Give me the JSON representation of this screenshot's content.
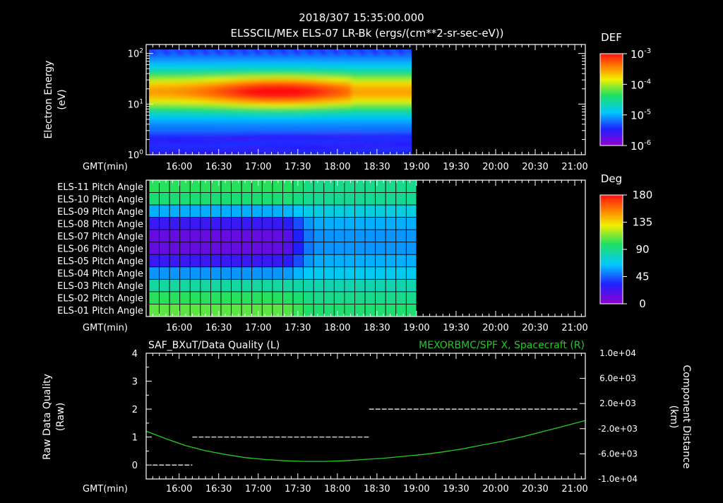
{
  "header": {
    "title": "2018/307 15:35:00.000",
    "subtitle": "ELSSCIL/MEx ELS-07 LR-Bk  (ergs/(cm**2-sr-sec-eV))"
  },
  "time_axis": {
    "label": "GMT(min)",
    "ticks": [
      "16:00",
      "16:30",
      "17:00",
      "17:30",
      "18:00",
      "18:30",
      "19:00",
      "19:30",
      "20:00",
      "20:30",
      "21:00"
    ],
    "tick_minutes": [
      960,
      990,
      1020,
      1050,
      1080,
      1110,
      1140,
      1170,
      1200,
      1230,
      1260
    ],
    "range_minutes": [
      935,
      1268
    ],
    "data_end_minutes": 1140
  },
  "colors": {
    "background": "#000000",
    "axis": "#ffffff",
    "green_series": "#22cc22"
  },
  "chart_data": [
    {
      "type": "heatmap",
      "name": "spectrogram",
      "ylabel_line1": "Electron Energy",
      "ylabel_line2": "(eV)",
      "y_scale": "log",
      "ylim": [
        1,
        150
      ],
      "y_ticks": [
        {
          "value": 100,
          "base": "10",
          "exp": "2"
        },
        {
          "value": 10,
          "base": "10",
          "exp": "1"
        },
        {
          "value": 1,
          "base": "10",
          "exp": "0"
        }
      ],
      "colorbar": {
        "label": "DEF",
        "scale": "log",
        "range": [
          1e-06,
          0.001
        ],
        "ticks": [
          {
            "base": "10",
            "exp": "-3"
          },
          {
            "base": "10",
            "exp": "-4"
          },
          {
            "base": "10",
            "exp": "-5"
          },
          {
            "base": "10",
            "exp": "-6"
          }
        ]
      },
      "peak_energy_ev": 18,
      "peak_time_minutes": 1035
    },
    {
      "type": "heatmap",
      "name": "pitch-angles",
      "rows": [
        "ELS-11 Pitch Angle",
        "ELS-10 Pitch Angle",
        "ELS-09 Pitch Angle",
        "ELS-08 Pitch Angle",
        "ELS-07 Pitch Angle",
        "ELS-06 Pitch Angle",
        "ELS-05 Pitch Angle",
        "ELS-04 Pitch Angle",
        "ELS-03 Pitch Angle",
        "ELS-02 Pitch Angle",
        "ELS-01 Pitch Angle"
      ],
      "colorbar": {
        "label": "Deg",
        "range": [
          0,
          180
        ],
        "ticks": [
          "180",
          "135",
          "90",
          "45",
          "0"
        ]
      },
      "phase_a_end_minutes": 1050,
      "phase_a_deg": [
        100,
        95,
        60,
        25,
        12,
        12,
        25,
        55,
        85,
        100,
        108
      ],
      "phase_b_deg": [
        90,
        88,
        72,
        60,
        55,
        55,
        60,
        68,
        82,
        90,
        96
      ]
    },
    {
      "type": "line",
      "name": "data-quality-and-distance",
      "left_title": "SAF_BXuT/Data Quality (L)",
      "right_title": "MEXORBMC/SPF X, Spacecraft (R)",
      "ylabel_left_line1": "Raw Data Quality",
      "ylabel_left_line2": "(Raw)",
      "ylabel_right_line1": "Component Distance",
      "ylabel_right_line2": "(km)",
      "ylim_left": [
        -0.5,
        4
      ],
      "y_ticks_left": [
        "4",
        "3",
        "2",
        "1",
        "0"
      ],
      "ylim_right": [
        -10000,
        10000
      ],
      "y_ticks_right": [
        "1.0e+04",
        "6.0e+03",
        "2.0e+03",
        "-2.0e+03",
        "-6.0e+03",
        "-1.0e+04"
      ],
      "series": [
        {
          "axis": "left",
          "color": "#ffffff",
          "style": "dashed",
          "segments": [
            {
              "x": [
                940,
                970
              ],
              "y": 0
            },
            {
              "x": [
                970,
                1104
              ],
              "y": 1
            },
            {
              "x": [
                1104,
                1262
              ],
              "y": 2
            }
          ]
        },
        {
          "axis": "right",
          "color": "#22cc22",
          "x": [
            935,
            950,
            965,
            980,
            995,
            1010,
            1025,
            1040,
            1055,
            1070,
            1085,
            1100,
            1115,
            1130,
            1145,
            1160,
            1175,
            1190,
            1205,
            1220,
            1235,
            1250,
            1268
          ],
          "y": [
            -2400,
            -3600,
            -4700,
            -5500,
            -6100,
            -6600,
            -6900,
            -7100,
            -7200,
            -7200,
            -7100,
            -6900,
            -6700,
            -6400,
            -6100,
            -5700,
            -5200,
            -4600,
            -4000,
            -3300,
            -2500,
            -1700,
            -700
          ]
        }
      ]
    }
  ]
}
